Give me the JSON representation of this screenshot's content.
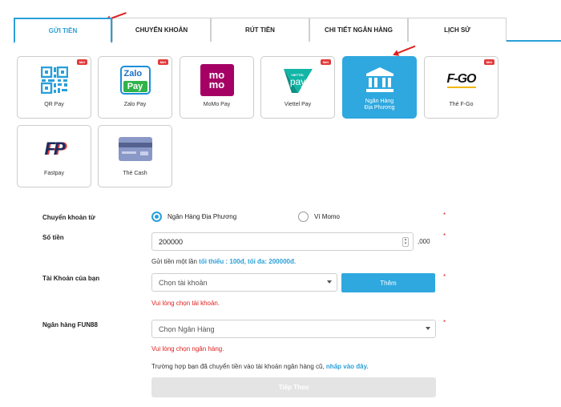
{
  "tabs": [
    {
      "label": "GỬI TIỀN",
      "active": true
    },
    {
      "label": "CHUYỂN KHOẢN",
      "active": false
    },
    {
      "label": "RÚT TIỀN",
      "active": false
    },
    {
      "label": "CHI TIẾT NGÂN HÀNG",
      "active": false
    },
    {
      "label": "LỊCH SỬ",
      "active": false
    }
  ],
  "methods": [
    {
      "label": "QR Pay",
      "badge": "Mới",
      "icon": "qr-code-icon"
    },
    {
      "label": "Zalo Pay",
      "badge": "Mới",
      "icon": "zalopay-logo"
    },
    {
      "label": "MoMo Pay",
      "badge": "",
      "icon": "momo-logo"
    },
    {
      "label": "Viettel Pay",
      "badge": "Mới",
      "icon": "viettelpay-logo"
    },
    {
      "label": "Ngân Hàng\nĐịa Phương",
      "badge": "",
      "icon": "bank-icon",
      "active": true
    },
    {
      "label": "Thẻ F-Go",
      "badge": "Mới",
      "icon": "fgo-logo"
    },
    {
      "label": "Fastpay",
      "badge": "",
      "icon": "fastpay-logo"
    },
    {
      "label": "Thẻ Cash",
      "badge": "",
      "icon": "card-icon"
    }
  ],
  "logos": {
    "zalo_top": "Zalo",
    "zalo_bottom": "Pay",
    "momo_top": "mo",
    "momo_bottom": "mo",
    "viettel_small": "VIETTEL",
    "viettel_big": "pay",
    "fgo": "F-GO",
    "fp": "FP"
  },
  "form": {
    "transfer_from_label": "Chuyển khoản từ",
    "option_local_bank": "Ngân Hàng Địa Phương",
    "option_momo": "Ví Momo",
    "amount_label": "Số tiền",
    "amount_value": "200000",
    "amount_suffix": ",000",
    "limit_prefix": "Gửi tiền một lần ",
    "limit_value": "tối thiểu : 100đ, tối đa: 200000đ.",
    "account_label": "Tài Khoản của bạn",
    "account_placeholder": "Chọn tài khoản",
    "add_button": "Thêm",
    "account_error": "Vui lòng chọn tài khoản.",
    "bank_label": "Ngân hàng FUN88",
    "bank_placeholder": "Chọn Ngân Hàng",
    "bank_error": "Vui lòng chọn ngân hàng.",
    "note_text": "Trường hợp bạn đã chuyển tiền vào tài khoản ngân hàng cũ, ",
    "note_link": "nhấp vào đây.",
    "next_button": "Tiếp Theo",
    "required_mark": "*"
  },
  "colors": {
    "accent": "#2a9fd8",
    "error": "#e02020",
    "badge": "#e23b3b"
  }
}
